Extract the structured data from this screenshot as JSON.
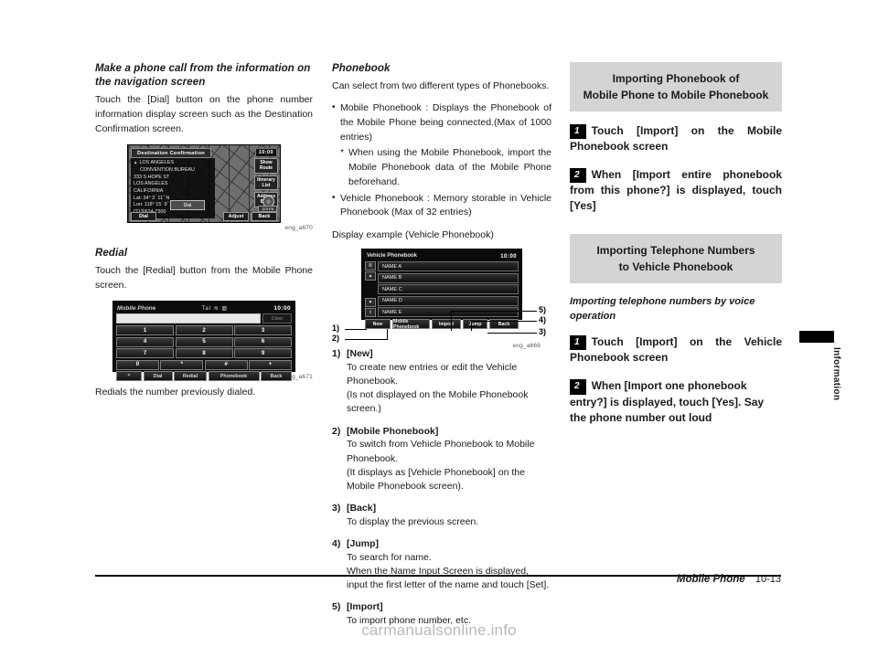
{
  "footer": {
    "chapter": "Mobile Phone",
    "page": "10-13",
    "side_tab": "Information",
    "watermark": "carmanualsonline.info"
  },
  "left_column": {
    "heading": "Make a phone call from the information on the navigation screen",
    "paragraph": "Touch the [Dial] button on the phone number information display screen such as the Destination Confirmation screen.",
    "figure_caption": "eng_a670",
    "nav_screen": {
      "title": "Destination Confirmation",
      "clock": "10:00",
      "info_lines": [
        "LOS ANGELES",
        "CONVENTION BUREAU",
        "333 S HOPE ST",
        "LOS ANGELES",
        "CALIFORNIA",
        "Lat:   34°  3´ 11˝ N",
        "Lon: 118° 15´  9˝ W",
        "(213)624-7300"
      ],
      "side_buttons": [
        "Show Route",
        "Itinerary List",
        "Address Book"
      ],
      "map_scale": "1/4 mi",
      "dial_box": "Dial",
      "bottom_buttons": [
        "Dial",
        "Adjust",
        "Back"
      ]
    },
    "redial": {
      "heading": "Redial",
      "paragraph": "Touch the [Redial] button from the Mobile Phone screen.",
      "caption": "Redials the number previously dialed.",
      "figure_caption": "eng_a671",
      "phone_screen": {
        "title": "Mobile Phone",
        "status": "Tal  ≋  ▥",
        "clock": "10:00",
        "input_value": "",
        "clear_label": "Clear",
        "keys": [
          [
            "1",
            "2",
            "3"
          ],
          [
            "4",
            "5",
            "6"
          ],
          [
            "7",
            "8",
            "9"
          ],
          [
            "0",
            "*",
            "#",
            "+"
          ]
        ],
        "bottom_buttons": [
          "^",
          "Dial",
          "Redial",
          "Phonebook",
          "Back"
        ]
      }
    }
  },
  "mid_column": {
    "heading": "Phonebook",
    "intro": "Can select from two different types of Phonebooks.",
    "bullets": [
      "Mobile Phonebook : Displays the Phonebook of the Mobile Phone being connected.(Max of 1000 entries)",
      "Vehicle Phonebook : Memory storable in Vehicle Phonebook (Max of 32 entries)"
    ],
    "sub_note": "When using the Mobile Phonebook, import the Mobile Phonebook data of the Mobile Phone beforehand.",
    "display_example_label": "Display example (Vehicle Phonebook)",
    "figure_caption": "eng_a669",
    "phonebook_screen": {
      "title": "Vehicle Phonebook",
      "clock": "10:00",
      "entries": [
        "NAME A",
        "NAME B",
        "NAME C",
        "NAME D",
        "NAME E"
      ],
      "scroll_buttons": [
        "≣",
        "▲",
        "▼",
        "⇳"
      ],
      "bottom_buttons": [
        "New",
        "Mobile Phonebook",
        "Import",
        "Jump",
        "Back"
      ]
    },
    "callout_markers": [
      "1)",
      "2)",
      "3)",
      "4)",
      "5)"
    ],
    "callouts": [
      {
        "num": "1)",
        "title": "[New]",
        "lines": [
          "To create new entries or edit the Vehicle Phonebook.",
          "(Is not displayed on the Mobile Phonebook screen.)"
        ]
      },
      {
        "num": "2)",
        "title": "[Mobile Phonebook]",
        "lines": [
          "To switch from Vehicle Phonebook to Mobile Phonebook.",
          "(It displays as [Vehicle Phonebook] on the Mobile Phonebook screen)."
        ]
      },
      {
        "num": "3)",
        "title": "[Back]",
        "lines": [
          "To display the previous screen."
        ]
      },
      {
        "num": "4)",
        "title": "[Jump]",
        "lines": [
          "To search for name.",
          "When the Name Input Screen is displayed, input the first letter of the name and touch [Set]."
        ]
      },
      {
        "num": "5)",
        "title": "[Import]",
        "lines": [
          "To import phone number, etc."
        ]
      }
    ]
  },
  "right_column": {
    "section_1": {
      "header_line1": "Importing Phonebook of",
      "header_line2": "Mobile Phone to Mobile Phonebook",
      "steps": [
        {
          "badge": "1",
          "text": "Touch [Import] on the Mobile Phonebook screen"
        },
        {
          "badge": "2",
          "text": "When [Import entire phonebook from this phone?] is displayed, touch [Yes]"
        }
      ]
    },
    "section_2": {
      "header_line1": "Importing Telephone Numbers",
      "header_line2": "to Vehicle Phonebook",
      "subheading": "Importing telephone numbers by voice operation",
      "steps": [
        {
          "badge": "1",
          "text": "Touch [Import] on the Vehicle Phonebook screen"
        },
        {
          "badge": "2",
          "text": "When [Import one phonebook entry?] is displayed, touch [Yes]. Say the phone number out loud"
        }
      ]
    }
  }
}
